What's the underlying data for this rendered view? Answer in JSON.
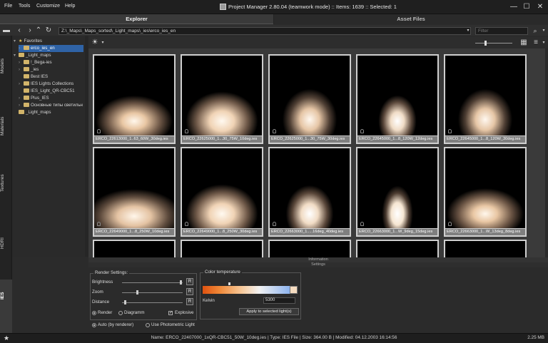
{
  "menu": [
    "File",
    "Tools",
    "Customize",
    "Help"
  ],
  "title": "Project Manager 2.80.04 (teamwork mode)  :: Items: 1639  :: Selected: 1",
  "window_controls": {
    "minimize": "—",
    "maximize": "☐",
    "close": "✕"
  },
  "tabs": {
    "explorer": "Explorer",
    "asset_files": "Asset Files"
  },
  "toolbar": {
    "path": "Z:\\_Maps\\_Maps_sorted\\_Light_maps\\_ies\\erco_ies_en",
    "filter_placeholder": "Filter"
  },
  "side_tabs": [
    "Models",
    "Materials",
    "Textures",
    "HDRI",
    "IES"
  ],
  "tree": [
    {
      "label": "Favorites",
      "type": "star"
    },
    {
      "label": "erco_ies_en",
      "type": "folder",
      "selected": true
    },
    {
      "label": "_Light_maps",
      "type": "folder"
    },
    {
      "label": "!_Bega-ies",
      "type": "folder"
    },
    {
      "label": "_ies",
      "type": "folder"
    },
    {
      "label": "Best IES",
      "type": "folder"
    },
    {
      "label": "IES Lights Collections",
      "type": "folder"
    },
    {
      "label": "IES_Light_QR-CBC51",
      "type": "folder"
    },
    {
      "label": "Plus_IES",
      "type": "folder"
    },
    {
      "label": "Основные типы светильн",
      "type": "folder"
    },
    {
      "label": "_Light_maps",
      "type": "folder"
    }
  ],
  "thumbnails": [
    {
      "label": "ERCO_22613000_1..63_60W_30deg.ies",
      "shape": "wide"
    },
    {
      "label": "ERCO_22625000_1...30_75W_10deg.ies",
      "shape": "wide2"
    },
    {
      "label": "ERCO_22625000_1...30_75W_30deg.ies",
      "shape": "cone"
    },
    {
      "label": "ERCO_22645000_1...8_120W_12deg.ies",
      "shape": "narrow"
    },
    {
      "label": "ERCO_22645000_1...8_120W_30deg.ies",
      "shape": "cone"
    },
    {
      "label": "ERCO_22649000_1...8_250W_10deg.ies",
      "shape": "flat"
    },
    {
      "label": "ERCO_22649000_1...8_250W_30deg.ies",
      "shape": "wide2"
    },
    {
      "label": "ERCO_22663000_1.....16deg_40deg.ies",
      "shape": "beam"
    },
    {
      "label": "ERCO_22663000_1...W_9deg_15deg.ies",
      "shape": "narrow2"
    },
    {
      "label": "ERCO_22663000_1...W_13deg_8deg.ies",
      "shape": "wide"
    }
  ],
  "panels": {
    "information": "Information",
    "settings": "Settings"
  },
  "render_settings": {
    "title": "Render Settings:",
    "brightness": "Brightness",
    "zoom": "Zoom",
    "distance": "Distance",
    "reset": "R",
    "render": "Render",
    "diagramm": "Diagramm",
    "explosive": "Explosive",
    "auto": "Auto (by renderer)",
    "photometric": "Use Photometric Light",
    "brightness_level": 0.97,
    "zoom_level": 0.25,
    "distance_level": 0.05
  },
  "color_temperature": {
    "title": "Color temperature",
    "kelvin_label": "Kelvin",
    "kelvin_value": "5300",
    "apply": "Apply to selected light(s)"
  },
  "status": {
    "text": "Name: ERCO_22407000_1xQR-CBC51_50W_10deg.ies | Type: IES File | Size: 364.00 B | Modified: 04.12.2003 16:14:56",
    "memory": "2.25 MB"
  }
}
